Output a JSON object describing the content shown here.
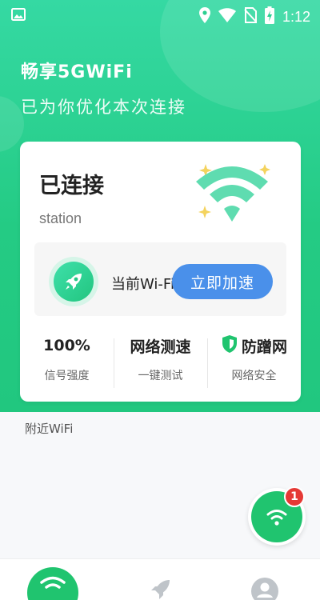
{
  "status_bar": {
    "time": "1:12",
    "icons": [
      "image-icon",
      "location-icon",
      "wifi-signal-icon",
      "no-sim-icon",
      "battery-charging-icon"
    ]
  },
  "header": {
    "title": "畅享5GWiFi",
    "subtitle": "已为你优化本次连接"
  },
  "card": {
    "status": "已连接",
    "ssid": "station",
    "speed_label": "当前Wi-Fi",
    "boost_button": "立即加速",
    "stats": [
      {
        "value": "100%",
        "label": "信号强度"
      },
      {
        "value": "网络测速",
        "label": "一键测试"
      },
      {
        "value": "防蹭网",
        "label": "网络安全"
      }
    ]
  },
  "nearby": {
    "label": "附近WiFi"
  },
  "fab": {
    "badge": "1"
  },
  "tabs": [
    "wifi-tab",
    "rocket-tab",
    "profile-tab"
  ],
  "colors": {
    "accent_green": "#21c77f",
    "button_blue": "#4a90ea",
    "badge_red": "#e53935"
  }
}
